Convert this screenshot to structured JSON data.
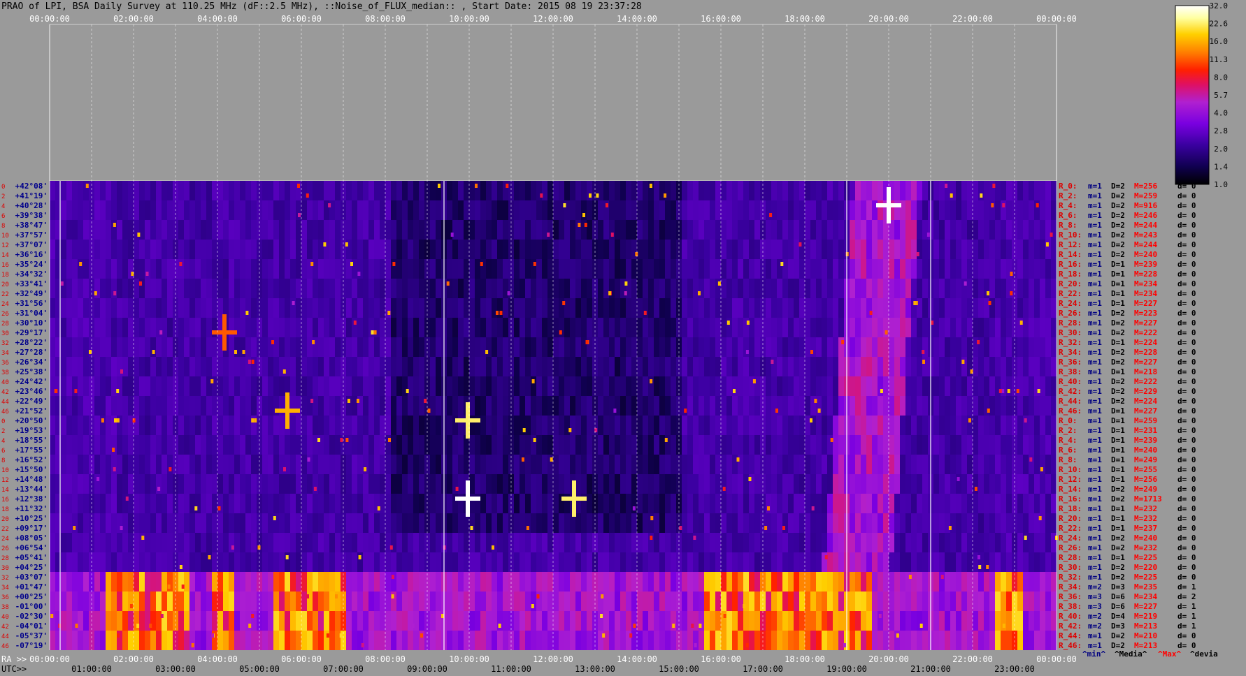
{
  "title": "PRAO of LPI, BSA Daily Survey at 110.25 MHz (dF::2.5 MHz), ::Noise_of_FLUX_median:: , Start Date: 2015 08 19 23:37:28",
  "chart_data": {
    "type": "heatmap",
    "title": "PRAO of LPI, BSA Daily Survey at 110.25 MHz (dF::2.5 MHz), ::Noise_of_FLUX_median:: , Start Date: 2015 08 19 23:37:28",
    "x_top_ticks": [
      "00:00:00",
      "02:00:00",
      "04:00:00",
      "06:00:00",
      "08:00:00",
      "10:00:00",
      "12:00:00",
      "14:00:00",
      "16:00:00",
      "18:00:00",
      "20:00:00",
      "22:00:00",
      "00:00:00"
    ],
    "ra_label": "RA >>",
    "ra_ticks": [
      "00:00:00",
      "02:00:00",
      "04:00:00",
      "06:00:00",
      "08:00:00",
      "10:00:00",
      "12:00:00",
      "14:00:00",
      "16:00:00",
      "18:00:00",
      "20:00:00",
      "22:00:00",
      "00:00:00"
    ],
    "utc_label": "UTC>>",
    "utc_ticks": [
      "01:00:00",
      "03:00:00",
      "05:00:00",
      "07:00:00",
      "09:00:00",
      "11:00:00",
      "13:00:00",
      "15:00:00",
      "17:00:00",
      "19:00:00",
      "21:00:00",
      "23:00:00"
    ],
    "declinations": [
      "+42°08'",
      "+41°19'",
      "+40°28'",
      "+39°38'",
      "+38°47'",
      "+37°57'",
      "+37°07'",
      "+36°16'",
      "+35°24'",
      "+34°32'",
      "+33°41'",
      "+32°49'",
      "+31°56'",
      "+31°04'",
      "+30°10'",
      "+29°17'",
      "+28°22'",
      "+27°28'",
      "+26°34'",
      "+25°38'",
      "+24°42'",
      "+23°46'",
      "+22°49'",
      "+21°52'",
      "+20°50'",
      "+19°53'",
      "+18°55'",
      "+17°55'",
      "+16°52'",
      "+15°50'",
      "+14°48'",
      "+13°44'",
      "+12°38'",
      "+11°32'",
      "+10°25'",
      "+09°17'",
      "+08°05'",
      "+06°54'",
      "+05°41'",
      "+04°25'",
      "+03°07'",
      "+01°47'",
      "+00°25'",
      "-01°00'",
      "-02°30'",
      "-04°01'",
      "-05°37'",
      "-07°19'"
    ],
    "beam_numbers": [
      "0",
      "2",
      "4",
      "6",
      "8",
      "10",
      "12",
      "14",
      "16",
      "18",
      "20",
      "22",
      "24",
      "26",
      "28",
      "30",
      "32",
      "34",
      "36",
      "38",
      "40",
      "42",
      "44",
      "46",
      "0",
      "2",
      "4",
      "6",
      "8",
      "10",
      "12",
      "14",
      "16",
      "18",
      "20",
      "22",
      "24",
      "26",
      "28",
      "30",
      "32",
      "34",
      "36",
      "38",
      "40",
      "42",
      "44",
      "46"
    ],
    "beam_stats": [
      [
        "R_0:",
        "m=1",
        "D=2",
        "M=256",
        "d= 0"
      ],
      [
        "R_2:",
        "m=1",
        "D=2",
        "M=259",
        "d= 0"
      ],
      [
        "R_4:",
        "m=1",
        "D=2",
        "M=916",
        "d= 0"
      ],
      [
        "R_6:",
        "m=1",
        "D=2",
        "M=246",
        "d= 0"
      ],
      [
        "R_8:",
        "m=1",
        "D=2",
        "M=244",
        "d= 0"
      ],
      [
        "R_10:",
        "m=1",
        "D=2",
        "M=243",
        "d= 0"
      ],
      [
        "R_12:",
        "m=1",
        "D=2",
        "M=244",
        "d= 0"
      ],
      [
        "R_14:",
        "m=1",
        "D=2",
        "M=240",
        "d= 0"
      ],
      [
        "R_16:",
        "m=1",
        "D=1",
        "M=239",
        "d= 0"
      ],
      [
        "R_18:",
        "m=1",
        "D=1",
        "M=228",
        "d= 0"
      ],
      [
        "R_20:",
        "m=1",
        "D=1",
        "M=234",
        "d= 0"
      ],
      [
        "R_22:",
        "m=1",
        "D=1",
        "M=234",
        "d= 0"
      ],
      [
        "R_24:",
        "m=1",
        "D=1",
        "M=227",
        "d= 0"
      ],
      [
        "R_26:",
        "m=1",
        "D=2",
        "M=223",
        "d= 0"
      ],
      [
        "R_28:",
        "m=1",
        "D=2",
        "M=227",
        "d= 0"
      ],
      [
        "R_30:",
        "m=1",
        "D=2",
        "M=222",
        "d= 0"
      ],
      [
        "R_32:",
        "m=1",
        "D=1",
        "M=224",
        "d= 0"
      ],
      [
        "R_34:",
        "m=1",
        "D=2",
        "M=228",
        "d= 0"
      ],
      [
        "R_36:",
        "m=1",
        "D=2",
        "M=227",
        "d= 0"
      ],
      [
        "R_38:",
        "m=1",
        "D=1",
        "M=218",
        "d= 0"
      ],
      [
        "R_40:",
        "m=1",
        "D=2",
        "M=222",
        "d= 0"
      ],
      [
        "R_42:",
        "m=1",
        "D=2",
        "M=229",
        "d= 0"
      ],
      [
        "R_44:",
        "m=1",
        "D=2",
        "M=224",
        "d= 0"
      ],
      [
        "R_46:",
        "m=1",
        "D=1",
        "M=227",
        "d= 0"
      ],
      [
        "R_0:",
        "m=1",
        "D=1",
        "M=259",
        "d= 0"
      ],
      [
        "R_2:",
        "m=1",
        "D=1",
        "M=231",
        "d= 0"
      ],
      [
        "R_4:",
        "m=1",
        "D=1",
        "M=239",
        "d= 0"
      ],
      [
        "R_6:",
        "m=1",
        "D=1",
        "M=240",
        "d= 0"
      ],
      [
        "R_8:",
        "m=1",
        "D=1",
        "M=249",
        "d= 0"
      ],
      [
        "R_10:",
        "m=1",
        "D=1",
        "M=255",
        "d= 0"
      ],
      [
        "R_12:",
        "m=1",
        "D=1",
        "M=256",
        "d= 0"
      ],
      [
        "R_14:",
        "m=1",
        "D=2",
        "M=249",
        "d= 0"
      ],
      [
        "R_16:",
        "m=1",
        "D=2",
        "M=1713",
        "d= 0"
      ],
      [
        "R_18:",
        "m=1",
        "D=1",
        "M=232",
        "d= 0"
      ],
      [
        "R_20:",
        "m=1",
        "D=1",
        "M=232",
        "d= 0"
      ],
      [
        "R_22:",
        "m=1",
        "D=1",
        "M=237",
        "d= 0"
      ],
      [
        "R_24:",
        "m=1",
        "D=2",
        "M=240",
        "d= 0"
      ],
      [
        "R_26:",
        "m=1",
        "D=2",
        "M=232",
        "d= 0"
      ],
      [
        "R_28:",
        "m=1",
        "D=1",
        "M=225",
        "d= 0"
      ],
      [
        "R_30:",
        "m=1",
        "D=2",
        "M=220",
        "d= 0"
      ],
      [
        "R_32:",
        "m=1",
        "D=2",
        "M=225",
        "d= 0"
      ],
      [
        "R_34:",
        "m=2",
        "D=3",
        "M=235",
        "d= 1"
      ],
      [
        "R_36:",
        "m=3",
        "D=6",
        "M=234",
        "d= 2"
      ],
      [
        "R_38:",
        "m=3",
        "D=6",
        "M=227",
        "d= 1"
      ],
      [
        "R_40:",
        "m=2",
        "D=4",
        "M=219",
        "d= 1"
      ],
      [
        "R_42:",
        "m=2",
        "D=3",
        "M=213",
        "d= 1"
      ],
      [
        "R_44:",
        "m=1",
        "D=2",
        "M=210",
        "d= 0"
      ],
      [
        "R_46:",
        "m=1",
        "D=2",
        "M=213",
        "d= 0"
      ]
    ],
    "stats_legend": [
      "^min^",
      "^Media^",
      "^Max^",
      "^devia"
    ],
    "stats_legend_colors": [
      "#000080",
      "#000000",
      "#ff0000",
      "#000000"
    ],
    "colorbar_ticks": [
      "32.0",
      "22.6",
      "16.0",
      "11.3",
      "8.0",
      "5.7",
      "4.0",
      "2.8",
      "2.0",
      "1.4",
      "1.0"
    ],
    "colorbar_values": [
      32.0,
      22.6,
      16.0,
      11.3,
      8.0,
      5.7,
      4.0,
      2.8,
      2.0,
      1.4,
      1.0
    ],
    "colorbar_scale": "log",
    "colormap": [
      "#000000",
      "#100050",
      "#3a00a0",
      "#7a00e0",
      "#b020d0",
      "#e01060",
      "#ff2000",
      "#ff8000",
      "#ffd000",
      "#ffffa0",
      "#ffffff"
    ],
    "hot_sources": [
      {
        "ra": "20:00:00",
        "dec": "+40°28'",
        "value": 32.0
      },
      {
        "ra": "09:58:00",
        "dec": "+12°38'",
        "value": 32.0
      },
      {
        "ra": "09:58:00",
        "dec": "+20°50'",
        "value": 22.6
      },
      {
        "ra": "05:40:00",
        "dec": "+21°52'",
        "value": 16.0
      },
      {
        "ra": "12:30:00",
        "dec": "+12°38'",
        "value": 22.6
      },
      {
        "ra": "04:10:00",
        "dec": "+29°17'",
        "value": 11.3
      }
    ],
    "galactic_band_dec": [
      "+01°47'",
      "-04°01'"
    ],
    "grid": true
  },
  "colors": {
    "background": "#9a9a9a",
    "grid_line": "#ffffff",
    "dec_label": "#00008b",
    "beam_number": "#dd0000",
    "stat_label": "#dd0000",
    "stat_min": "#000080",
    "stat_max": "#ff0000"
  }
}
